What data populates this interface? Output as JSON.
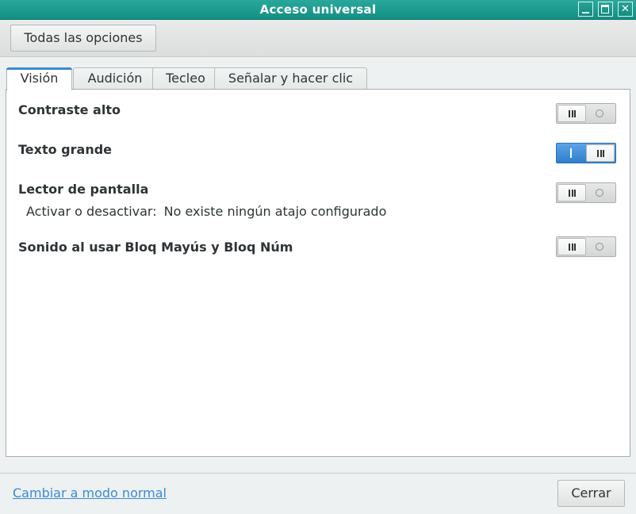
{
  "window": {
    "title": "Acceso universal"
  },
  "header": {
    "all_settings_label": "Todas las opciones"
  },
  "tabs": [
    {
      "label": "Visión",
      "active": true
    },
    {
      "label": "Audición",
      "active": false
    },
    {
      "label": "Tecleo",
      "active": false
    },
    {
      "label": "Señalar y hacer clic",
      "active": false
    }
  ],
  "vision": {
    "rows": [
      {
        "label": "Contraste alto",
        "state": "off"
      },
      {
        "label": "Texto grande",
        "state": "on"
      },
      {
        "label": "Lector de pantalla",
        "state": "off",
        "sub_label": "Activar o desactivar:",
        "sub_value": "No existe ningún atajo configurado"
      },
      {
        "label": "Sonido al usar Bloq Mayús y Bloq Núm",
        "state": "off"
      }
    ]
  },
  "footer": {
    "switch_mode_link": "Cambiar a modo normal",
    "close_label": "Cerrar"
  },
  "colors": {
    "titlebar": "#1a998d",
    "accent": "#3b8ad6",
    "switch_on": "#3f8ddb"
  }
}
